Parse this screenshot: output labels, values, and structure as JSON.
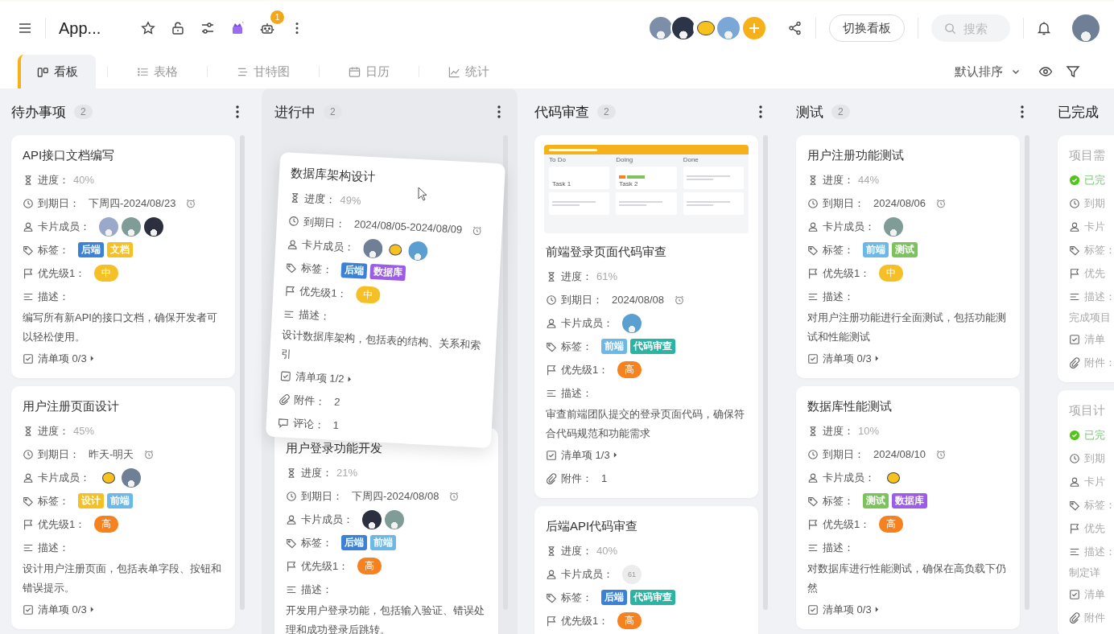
{
  "header": {
    "title": "App...",
    "robot_badge": "1",
    "members": [
      {
        "kind": "photo",
        "color": "#7d8fa8"
      },
      {
        "kind": "photo",
        "color": "#2c3448"
      },
      {
        "kind": "sun"
      },
      {
        "kind": "photo",
        "color": "#7aa7d6"
      }
    ],
    "switch_button": "切换看板",
    "search": {
      "placeholder": "搜索"
    },
    "user": {
      "kind": "photo",
      "color": "#6f7f96"
    }
  },
  "tabs": [
    {
      "label": "看板",
      "kind": "board",
      "selected": true
    },
    {
      "label": "表格",
      "kind": "table",
      "selected": false
    },
    {
      "label": "甘特图",
      "kind": "gantt",
      "selected": false
    },
    {
      "label": "日历",
      "kind": "calendar",
      "selected": false
    },
    {
      "label": "统计",
      "kind": "stats",
      "selected": false
    }
  ],
  "sort": {
    "label": "默认排序"
  },
  "columns": [
    {
      "title": "待办事项",
      "count": "2",
      "drop_target": false,
      "cards": [
        {
          "title": "API接口文档编写",
          "completed": false,
          "rows": [
            {
              "kind": "progress",
              "label": "进度：",
              "value": "40%"
            },
            {
              "kind": "due",
              "label": "到期日：",
              "value": "下周四-2024/08/23"
            },
            {
              "kind": "members",
              "label": "卡片成员：",
              "members": [
                {
                  "kind": "photo",
                  "color": "#9aa9c9"
                },
                {
                  "kind": "photo",
                  "color": "#7f9c96"
                },
                {
                  "kind": "photo",
                  "color": "#2b2f3e"
                }
              ]
            },
            {
              "kind": "tags",
              "label": "标签：",
              "tags": [
                {
                  "text": "后端",
                  "color": "#3b82d6"
                },
                {
                  "text": "文档",
                  "color": "#f5c026"
                }
              ]
            },
            {
              "kind": "priority",
              "label": "优先级1：",
              "badge": {
                "text": "中",
                "color": "#f5c026"
              }
            },
            {
              "kind": "desc",
              "label": "描述：",
              "text": "编写所有新API的接口文档，确保开发者可以轻松使用。"
            },
            {
              "kind": "checklist",
              "label": "清单项",
              "value": "0/3"
            }
          ]
        },
        {
          "title": "用户注册页面设计",
          "completed": false,
          "rows": [
            {
              "kind": "progress",
              "label": "进度：",
              "value": "45%"
            },
            {
              "kind": "due",
              "label": "到期日：",
              "value": "昨天-明天"
            },
            {
              "kind": "members",
              "label": "卡片成员：",
              "members": [
                {
                  "kind": "sun"
                },
                {
                  "kind": "photo",
                  "color": "#6f7f96"
                }
              ]
            },
            {
              "kind": "tags",
              "label": "标签：",
              "tags": [
                {
                  "text": "设计",
                  "color": "#f5c026"
                },
                {
                  "text": "前端",
                  "color": "#6cb8e6"
                }
              ]
            },
            {
              "kind": "priority",
              "label": "优先级1：",
              "badge": {
                "text": "高",
                "color": "#f5821f"
              }
            },
            {
              "kind": "desc",
              "label": "描述：",
              "text": "设计用户注册页面，包括表单字段、按钮和错误提示。"
            },
            {
              "kind": "checklist",
              "label": "清单项",
              "value": "0/3"
            }
          ]
        }
      ]
    },
    {
      "title": "进行中",
      "count": "2",
      "drop_target": true,
      "dragged_card": {
        "title": "数据库架构设计",
        "completed": false,
        "rows": [
          {
            "kind": "progress",
            "label": "进度：",
            "value": "49%"
          },
          {
            "kind": "due",
            "label": "到期日：",
            "value": "2024/08/05-2024/08/09"
          },
          {
            "kind": "members",
            "label": "卡片成员：",
            "members": [
              {
                "kind": "photo",
                "color": "#6f7f96"
              },
              {
                "kind": "sun"
              },
              {
                "kind": "photo",
                "color": "#5b9fd0"
              }
            ]
          },
          {
            "kind": "tags",
            "label": "标签：",
            "tags": [
              {
                "text": "后端",
                "color": "#3b82d6"
              },
              {
                "text": "数据库",
                "color": "#9b5de5"
              }
            ]
          },
          {
            "kind": "priority",
            "label": "优先级1：",
            "badge": {
              "text": "中",
              "color": "#f5c026"
            }
          },
          {
            "kind": "desc",
            "label": "描述：",
            "text": "设计数据库架构，包括表的结构、关系和索引"
          },
          {
            "kind": "checklist",
            "label": "清单项",
            "value": "1/2"
          },
          {
            "kind": "attach",
            "label": "附件：",
            "value": "2"
          },
          {
            "kind": "comment",
            "label": "评论：",
            "value": "1"
          }
        ]
      },
      "cards": [
        {
          "title": "用户登录功能开发",
          "completed": false,
          "rows": [
            {
              "kind": "progress",
              "label": "进度：",
              "value": "21%"
            },
            {
              "kind": "due",
              "label": "到期日：",
              "value": "下周四-2024/08/08"
            },
            {
              "kind": "members",
              "label": "卡片成员：",
              "members": [
                {
                  "kind": "photo",
                  "color": "#2b2f3e"
                },
                {
                  "kind": "photo",
                  "color": "#7f9c96"
                }
              ]
            },
            {
              "kind": "tags",
              "label": "标签：",
              "tags": [
                {
                  "text": "后端",
                  "color": "#3b82d6"
                },
                {
                  "text": "前端",
                  "color": "#6cb8e6"
                }
              ]
            },
            {
              "kind": "priority",
              "label": "优先级1：",
              "badge": {
                "text": "高",
                "color": "#f5821f"
              }
            },
            {
              "kind": "desc",
              "label": "描述：",
              "text": "开发用户登录功能，包括输入验证、错误处理和成功登录后跳转。"
            }
          ]
        }
      ]
    },
    {
      "title": "代码审查",
      "count": "2",
      "drop_target": false,
      "cards": [
        {
          "title": "前端登录页面代码审查",
          "completed": false,
          "cover": {
            "columns": [
              {
                "title": "To Do",
                "tasks": [
                  "Task 1"
                ]
              },
              {
                "title": "Doing",
                "tasks": [
                  "Task 2"
                ]
              },
              {
                "title": "Done"
              }
            ]
          },
          "rows": [
            {
              "kind": "progress",
              "label": "进度：",
              "value": "61%"
            },
            {
              "kind": "due",
              "label": "到期日：",
              "value": "2024/08/08"
            },
            {
              "kind": "members",
              "label": "卡片成员：",
              "members": [
                {
                  "kind": "photo",
                  "color": "#5b9fd0"
                }
              ]
            },
            {
              "kind": "tags",
              "label": "标签：",
              "tags": [
                {
                  "text": "前端",
                  "color": "#6cb8e6"
                },
                {
                  "text": "代码审查",
                  "color": "#2bb3a3"
                }
              ]
            },
            {
              "kind": "priority",
              "label": "优先级1：",
              "badge": {
                "text": "高",
                "color": "#f5821f"
              }
            },
            {
              "kind": "desc",
              "label": "描述：",
              "text": "审查前端团队提交的登录页面代码，确保符合代码规范和功能需求"
            },
            {
              "kind": "checklist",
              "label": "清单项",
              "value": "1/3"
            },
            {
              "kind": "attach",
              "label": "附件：",
              "value": "1"
            }
          ]
        },
        {
          "title": "后端API代码审查",
          "completed": false,
          "rows": [
            {
              "kind": "progress",
              "label": "进度：",
              "value": "40%"
            },
            {
              "kind": "members",
              "label": "卡片成员：",
              "members": [
                {
                  "kind": "initials",
                  "text": "61"
                }
              ]
            },
            {
              "kind": "tags",
              "label": "标签：",
              "tags": [
                {
                  "text": "后端",
                  "color": "#3b82d6"
                },
                {
                  "text": "代码审查",
                  "color": "#2bb3a3"
                }
              ]
            },
            {
              "kind": "priority",
              "label": "优先级1：",
              "badge": {
                "text": "高",
                "color": "#f5821f"
              }
            }
          ]
        }
      ]
    },
    {
      "title": "测试",
      "count": "2",
      "drop_target": false,
      "cards": [
        {
          "title": "用户注册功能测试",
          "completed": false,
          "rows": [
            {
              "kind": "progress",
              "label": "进度：",
              "value": "44%"
            },
            {
              "kind": "due",
              "label": "到期日：",
              "value": "2024/08/06"
            },
            {
              "kind": "members",
              "label": "卡片成员：",
              "members": [
                {
                  "kind": "photo",
                  "color": "#7f9c96"
                }
              ]
            },
            {
              "kind": "tags",
              "label": "标签：",
              "tags": [
                {
                  "text": "前端",
                  "color": "#6cb8e6"
                },
                {
                  "text": "测试",
                  "color": "#7cc35b"
                }
              ]
            },
            {
              "kind": "priority",
              "label": "优先级1：",
              "badge": {
                "text": "中",
                "color": "#f5c026"
              }
            },
            {
              "kind": "desc",
              "label": "描述：",
              "text": "对用户注册功能进行全面测试，包括功能测试和性能测试"
            },
            {
              "kind": "checklist",
              "label": "清单项",
              "value": "0/3"
            }
          ]
        },
        {
          "title": "数据库性能测试",
          "completed": false,
          "rows": [
            {
              "kind": "progress",
              "label": "进度：",
              "value": "10%"
            },
            {
              "kind": "due",
              "label": "到期日：",
              "value": "2024/08/10"
            },
            {
              "kind": "members",
              "label": "卡片成员：",
              "members": [
                {
                  "kind": "sun"
                }
              ]
            },
            {
              "kind": "tags",
              "label": "标签：",
              "tags": [
                {
                  "text": "测试",
                  "color": "#7cc35b"
                },
                {
                  "text": "数据库",
                  "color": "#9b5de5"
                }
              ]
            },
            {
              "kind": "priority",
              "label": "优先级1：",
              "badge": {
                "text": "高",
                "color": "#f5821f"
              }
            },
            {
              "kind": "desc",
              "label": "描述：",
              "text": "对数据库进行性能测试，确保在高负载下仍然"
            },
            {
              "kind": "checklist",
              "label": "清单项",
              "value": "0/3"
            }
          ]
        }
      ]
    },
    {
      "title": "已完成",
      "drop_target": false,
      "cards": [
        {
          "title": "项目需",
          "completed": true,
          "rows": [
            {
              "kind": "status",
              "label": "已完"
            },
            {
              "kind": "due",
              "label": "到期"
            },
            {
              "kind": "members",
              "label": "卡片"
            },
            {
              "kind": "tags",
              "label": "标签："
            },
            {
              "kind": "priority",
              "label": "优先"
            },
            {
              "kind": "desc",
              "label": "描述：",
              "text": "完成项目"
            },
            {
              "kind": "checklist",
              "label": "清单"
            },
            {
              "kind": "attach",
              "label": "附件："
            }
          ]
        },
        {
          "title": "项目计",
          "completed": true,
          "rows": [
            {
              "kind": "status",
              "label": "已完"
            },
            {
              "kind": "due",
              "label": "到期"
            },
            {
              "kind": "members",
              "label": "卡片"
            },
            {
              "kind": "tags",
              "label": "标签："
            },
            {
              "kind": "priority",
              "label": "优先"
            },
            {
              "kind": "desc",
              "label": "描述：",
              "text": "制定详"
            },
            {
              "kind": "checklist",
              "label": "清单"
            },
            {
              "kind": "attach",
              "label": "附件"
            }
          ]
        }
      ]
    }
  ]
}
